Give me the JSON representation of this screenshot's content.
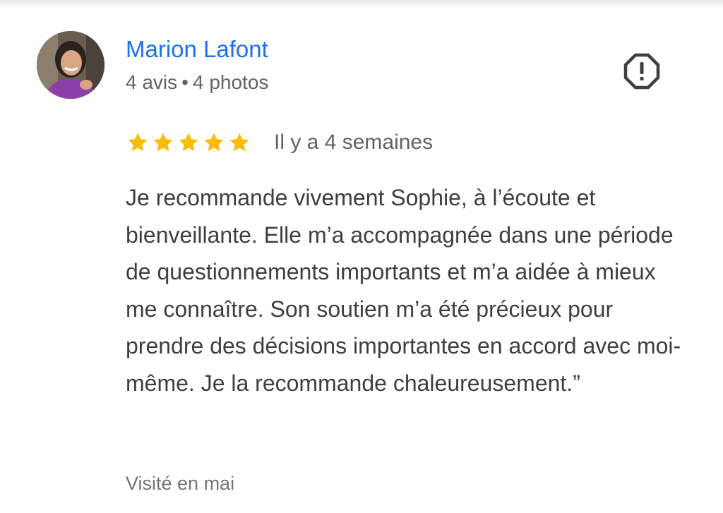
{
  "review": {
    "author": {
      "name": "Marion Lafont",
      "reviews_count": "4 avis",
      "separator": "•",
      "photos_count": "4 photos"
    },
    "rating": 5,
    "rating_max": 5,
    "date": "Il y a 4 semaines",
    "text": "Je recommande vivement Sophie, à l’écoute et bienveillante. Elle m’a accompagnée dans une période de questionnements importants et m’a aidée à mieux me connaître. Son soutien m’a été précieux pour prendre des décisions importantes en accord avec moi-même. Je la recommande chaleureusement.”",
    "visit": "Visité en mai"
  },
  "icons": {
    "report": "report-flag-icon",
    "star": "star-icon"
  },
  "colors": {
    "author_name": "#1a73e8",
    "star": "#fbbc04",
    "secondary_text": "#5f6368",
    "body_text": "#3c4043"
  }
}
